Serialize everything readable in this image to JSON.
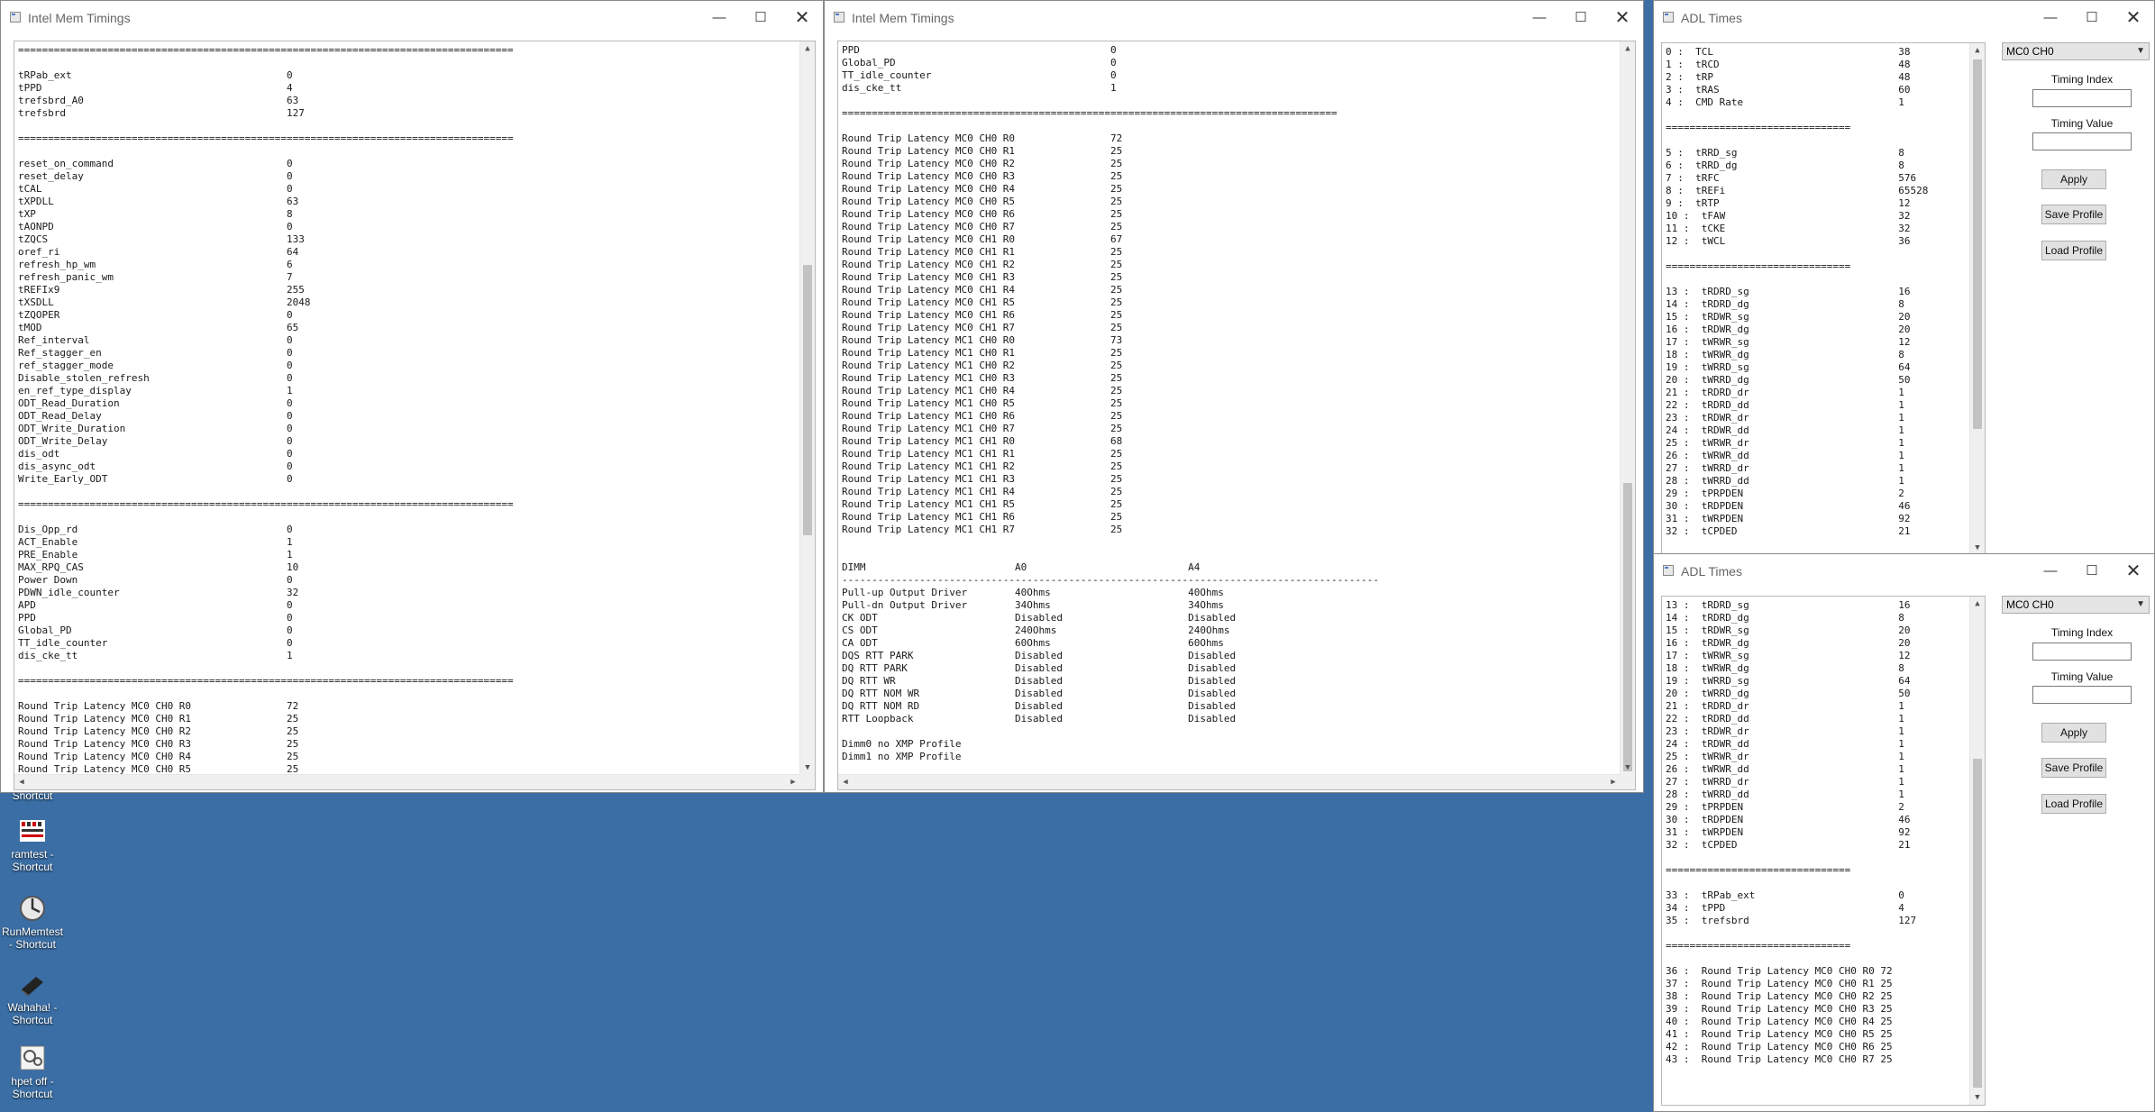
{
  "desktop": {
    "icons": [
      {
        "label": "Shortcut",
        "icon": "shortcut-icon"
      },
      {
        "label": "ramtest - Shortcut",
        "icon": "ramtest-icon"
      },
      {
        "label": "RunMemtest - Shortcut",
        "icon": "runmemtest-icon"
      },
      {
        "label": "Wahaha! - Shortcut",
        "icon": "wahaha-icon"
      },
      {
        "label": "hpet off - Shortcut",
        "icon": "hpet-icon"
      }
    ]
  },
  "window_controls": {
    "minimize": "—",
    "maximize": "☐",
    "close": "✕"
  },
  "win1": {
    "title": "Intel Mem Timings",
    "text": "===================================================================================\n\ntRPab_ext                                    0\ntPPD                                         4\ntrefsbrd_A0                                  63\ntrefsbrd                                     127\n\n===================================================================================\n\nreset_on_command                             0\nreset_delay                                  0\ntCAL                                         0\ntXPDLL                                       63\ntXP                                          8\ntAONPD                                       0\ntZQCS                                        133\noref_ri                                      64\nrefresh_hp_wm                                6\nrefresh_panic_wm                             7\ntREFIx9                                      255\ntXSDLL                                       2048\ntZQOPER                                      0\ntMOD                                         65\nRef_interval                                 0\nRef_stagger_en                               0\nref_stagger_mode                             0\nDisable_stolen_refresh                       0\nen_ref_type_display                          1\nODT_Read_Duration                            0\nODT_Read_Delay                               0\nODT_Write_Duration                           0\nODT_Write_Delay                              0\ndis_odt                                      0\ndis_async_odt                                0\nWrite_Early_ODT                              0\n\n===================================================================================\n\nDis_Opp_rd                                   0\nACT_Enable                                   1\nPRE_Enable                                   1\nMAX_RPQ_CAS                                  10\nPower Down                                   0\nPDWN_idle_counter                            32\nAPD                                          0\nPPD                                          0\nGlobal_PD                                    0\nTT_idle_counter                              0\ndis_cke_tt                                   1\n\n===================================================================================\n\nRound Trip Latency MC0 CH0 R0                72\nRound Trip Latency MC0 CH0 R1                25\nRound Trip Latency MC0 CH0 R2                25\nRound Trip Latency MC0 CH0 R3                25\nRound Trip Latency MC0 CH0 R4                25\nRound Trip Latency MC0 CH0 R5                25"
  },
  "win2": {
    "title": "Intel Mem Timings",
    "text": "PPD                                          0\nGlobal_PD                                    0\nTT_idle_counter                              0\ndis_cke_tt                                   1\n\n===================================================================================\n\nRound Trip Latency MC0 CH0 R0                72\nRound Trip Latency MC0 CH0 R1                25\nRound Trip Latency MC0 CH0 R2                25\nRound Trip Latency MC0 CH0 R3                25\nRound Trip Latency MC0 CH0 R4                25\nRound Trip Latency MC0 CH0 R5                25\nRound Trip Latency MC0 CH0 R6                25\nRound Trip Latency MC0 CH0 R7                25\nRound Trip Latency MC0 CH1 R0                67\nRound Trip Latency MC0 CH1 R1                25\nRound Trip Latency MC0 CH1 R2                25\nRound Trip Latency MC0 CH1 R3                25\nRound Trip Latency MC0 CH1 R4                25\nRound Trip Latency MC0 CH1 R5                25\nRound Trip Latency MC0 CH1 R6                25\nRound Trip Latency MC0 CH1 R7                25\nRound Trip Latency MC1 CH0 R0                73\nRound Trip Latency MC1 CH0 R1                25\nRound Trip Latency MC1 CH0 R2                25\nRound Trip Latency MC1 CH0 R3                25\nRound Trip Latency MC1 CH0 R4                25\nRound Trip Latency MC1 CH0 R5                25\nRound Trip Latency MC1 CH0 R6                25\nRound Trip Latency MC1 CH0 R7                25\nRound Trip Latency MC1 CH1 R0                68\nRound Trip Latency MC1 CH1 R1                25\nRound Trip Latency MC1 CH1 R2                25\nRound Trip Latency MC1 CH1 R3                25\nRound Trip Latency MC1 CH1 R4                25\nRound Trip Latency MC1 CH1 R5                25\nRound Trip Latency MC1 CH1 R6                25\nRound Trip Latency MC1 CH1 R7                25\n\n\nDIMM                         A0                           A4\n------------------------------------------------------------------------------------------\nPull-up Output Driver        40Ohms                       40Ohms\nPull-dn Output Driver        34Ohms                       34Ohms\nCK ODT                       Disabled                     Disabled\nCS ODT                       240Ohms                      240Ohms\nCA ODT                       60Ohms                       60Ohms\nDQS RTT PARK                 Disabled                     Disabled\nDQ RTT PARK                  Disabled                     Disabled\nDQ RTT WR                    Disabled                     Disabled\nDQ RTT NOM WR                Disabled                     Disabled\nDQ RTT NOM RD                Disabled                     Disabled\nRTT Loopback                 Disabled                     Disabled\n\nDimm0 no XMP Profile\nDimm1 no XMP Profile"
  },
  "adl1": {
    "title": "ADL Times",
    "text": "0 :  TCL                               38\n1 :  tRCD                              48\n2 :  tRP                               48\n3 :  tRAS                              60\n4 :  CMD Rate                          1\n\n===============================\n\n5 :  tRRD_sg                           8\n6 :  tRRD_dg                           8\n7 :  tRFC                              576\n8 :  tREFi                             65528\n9 :  tRTP                              12\n10 :  tFAW                             32\n11 :  tCKE                             32\n12 :  tWCL                             36\n\n===============================\n\n13 :  tRDRD_sg                         16\n14 :  tRDRD_dg                         8\n15 :  tRDWR_sg                         20\n16 :  tRDWR_dg                         20\n17 :  tWRWR_sg                         12\n18 :  tWRWR_dg                         8\n19 :  tWRRD_sg                         64\n20 :  tWRRD_dg                         50\n21 :  tRDRD_dr                         1\n22 :  tRDRD_dd                         1\n23 :  tRDWR_dr                         1\n24 :  tRDWR_dd                         1\n25 :  tWRWR_dr                         1\n26 :  tWRWR_dd                         1\n27 :  tWRRD_dr                         1\n28 :  tWRRD_dd                         1\n29 :  tPRPDEN                          2\n30 :  tRDPDEN                          46\n31 :  tWRPDEN                          92\n32 :  tCPDED                           21",
    "combo": "MC0 CH0",
    "timing_index_label": "Timing Index",
    "timing_value_label": "Timing Value",
    "timing_index_value": "",
    "timing_value_value": "",
    "apply": "Apply",
    "save": "Save Profile",
    "load": "Load Profile"
  },
  "adl2": {
    "title": "ADL Times",
    "text": "13 :  tRDRD_sg                         16\n14 :  tRDRD_dg                         8\n15 :  tRDWR_sg                         20\n16 :  tRDWR_dg                         20\n17 :  tWRWR_sg                         12\n18 :  tWRWR_dg                         8\n19 :  tWRRD_sg                         64\n20 :  tWRRD_dg                         50\n21 :  tRDRD_dr                         1\n22 :  tRDRD_dd                         1\n23 :  tRDWR_dr                         1\n24 :  tRDWR_dd                         1\n25 :  tWRWR_dr                         1\n26 :  tWRWR_dd                         1\n27 :  tWRRD_dr                         1\n28 :  tWRRD_dd                         1\n29 :  tPRPDEN                          2\n30 :  tRDPDEN                          46\n31 :  tWRPDEN                          92\n32 :  tCPDED                           21\n\n===============================\n\n33 :  tRPab_ext                        0\n34 :  tPPD                             4\n35 :  trefsbrd                         127\n\n===============================\n\n36 :  Round Trip Latency MC0 CH0 R0 72\n37 :  Round Trip Latency MC0 CH0 R1 25\n38 :  Round Trip Latency MC0 CH0 R2 25\n39 :  Round Trip Latency MC0 CH0 R3 25\n40 :  Round Trip Latency MC0 CH0 R4 25\n41 :  Round Trip Latency MC0 CH0 R5 25\n42 :  Round Trip Latency MC0 CH0 R6 25\n43 :  Round Trip Latency MC0 CH0 R7 25",
    "combo": "MC0 CH0",
    "timing_index_label": "Timing Index",
    "timing_value_label": "Timing Value",
    "timing_index_value": "",
    "timing_value_value": "",
    "apply": "Apply",
    "save": "Save Profile",
    "load": "Load Profile"
  }
}
